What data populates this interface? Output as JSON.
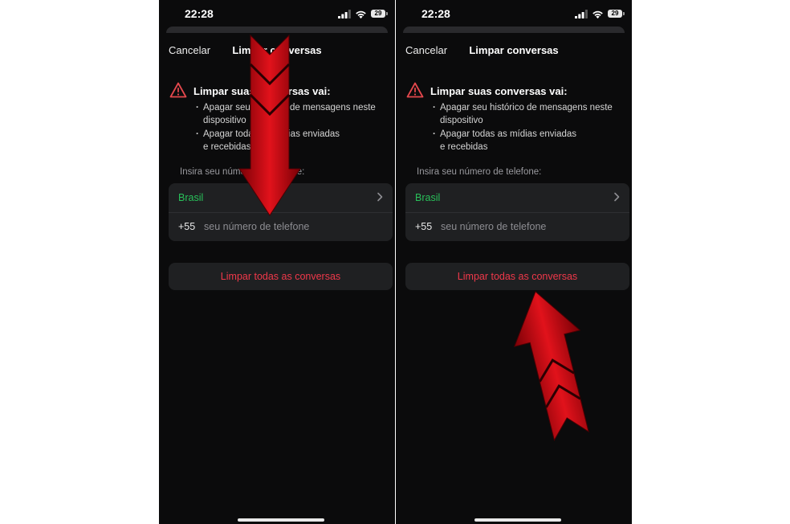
{
  "screens": [
    {
      "status": {
        "time": "22:28",
        "battery": "29"
      },
      "nav": {
        "cancel_label": "Cancelar",
        "title": "Limpar conversas"
      },
      "warning": {
        "title": "Limpar suas conversas vai:",
        "bullets": [
          {
            "lines": [
              "Apagar seu histórico de mensagens neste",
              "dispositivo"
            ]
          },
          {
            "lines": [
              "Apagar todas as mídias enviadas",
              "e recebidas"
            ]
          }
        ]
      },
      "phone_form": {
        "label": "Insira seu número de telefone:",
        "country": "Brasil",
        "country_code": "+55",
        "number_placeholder": "seu número de telefone",
        "number_value": ""
      },
      "clear_button_label": "Limpar todas as conversas"
    },
    {
      "status": {
        "time": "22:28",
        "battery": "29"
      },
      "nav": {
        "cancel_label": "Cancelar",
        "title": "Limpar conversas"
      },
      "warning": {
        "title": "Limpar suas conversas vai:",
        "bullets": [
          {
            "lines": [
              "Apagar seu histórico de mensagens neste",
              "dispositivo"
            ]
          },
          {
            "lines": [
              "Apagar todas as mídias enviadas",
              "e recebidas"
            ]
          }
        ]
      },
      "phone_form": {
        "label": "Insira seu número de telefone:",
        "country": "Brasil",
        "country_code": "+55",
        "number_placeholder": "seu número de telefone",
        "number_value": ""
      },
      "clear_button_label": "Limpar todas as conversas"
    }
  ],
  "colors": {
    "background": "#0b0b0c",
    "card": "#1f2022",
    "accent_green": "#29c05a",
    "destructive_red": "#f0384a",
    "warning_red": "#e5484d",
    "annotation_arrow": "#c8070e"
  },
  "icons": [
    "signal-icon",
    "wifi-icon",
    "battery-icon",
    "warning-icon",
    "chevron-right-icon",
    "annotation-arrow-down",
    "annotation-arrow-up"
  ]
}
